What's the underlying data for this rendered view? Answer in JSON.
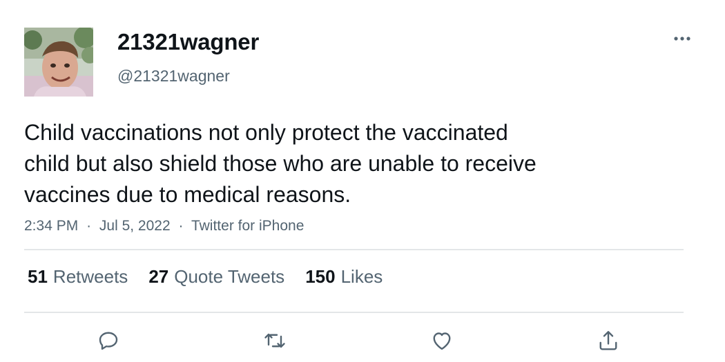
{
  "author": {
    "display_name": "21321wagner",
    "handle": "@21321wagner"
  },
  "tweet": {
    "text_lines": [
      "Child vaccinations not only protect the vaccinated",
      "child but also shield those who are unable to receive",
      "vaccines due to medical reasons."
    ],
    "time": "2:34 PM",
    "date": "Jul 5, 2022",
    "source": "Twitter for iPhone",
    "separator": "·"
  },
  "stats": {
    "retweets": {
      "count": "51",
      "label": "Retweets"
    },
    "quote_tweets": {
      "count": "27",
      "label": "Quote Tweets"
    },
    "likes": {
      "count": "150",
      "label": "Likes"
    }
  },
  "icons": {
    "more": "more-horizontal-icon",
    "reply": "reply-icon",
    "retweet": "retweet-icon",
    "like": "heart-icon",
    "share": "share-icon"
  },
  "colors": {
    "text": "#0f1419",
    "secondary": "#536471",
    "divider": "#e3e6e8"
  }
}
